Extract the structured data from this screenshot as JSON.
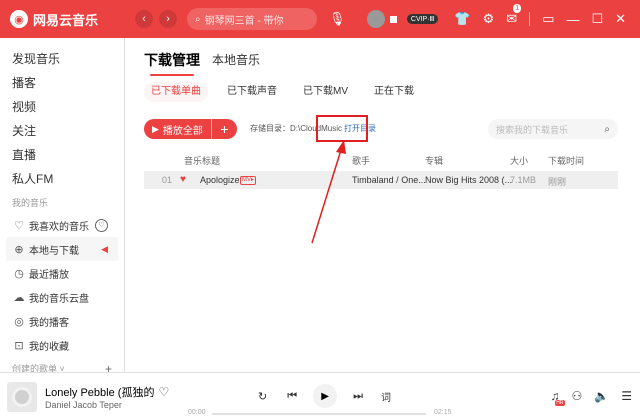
{
  "app": {
    "logo_text": "网易云音乐",
    "logo_glyph": "◉",
    "back": "‹",
    "forward": "›",
    "search_placeholder": "钢琴网三首 - 带你",
    "vip_label": "CVIP·Ⅲ",
    "message_count": "1",
    "accent_color": "#ec4141"
  },
  "sidebar": {
    "top_items": [
      {
        "label": "发现音乐"
      },
      {
        "label": "播客"
      },
      {
        "label": "视频"
      },
      {
        "label": "关注"
      },
      {
        "label": "直播"
      },
      {
        "label": "私人FM"
      }
    ],
    "my_music_heading": "我的音乐",
    "my_items": [
      {
        "label": "我喜欢的音乐",
        "icon": "heart-icon"
      },
      {
        "label": "本地与下载",
        "icon": "download-icon",
        "active": true
      },
      {
        "label": "最近播放",
        "icon": "clock-icon"
      },
      {
        "label": "我的音乐云盘",
        "icon": "cloud-icon"
      },
      {
        "label": "我的播客",
        "icon": "podcast-icon"
      },
      {
        "label": "我的收藏",
        "icon": "collect-icon"
      }
    ],
    "created_heading": "创建的歌单 ˅",
    "create_plus": "+"
  },
  "main": {
    "title": "下载管理",
    "title_alt": "本地音乐",
    "subtabs": [
      {
        "label": "已下载单曲",
        "active": true
      },
      {
        "label": "已下载声音"
      },
      {
        "label": "已下载MV"
      },
      {
        "label": "正在下载"
      }
    ],
    "play_all_label": "播放全部",
    "play_all_add": "+",
    "storage_label": "存储目录：D:\\CloudMusic",
    "open_dir_label": "打开目录",
    "search_placeholder": "搜索我的下载音乐",
    "table": {
      "headers": [
        "音乐标题",
        "歌手",
        "专辑",
        "大小",
        "下载时间"
      ],
      "rows": [
        {
          "num": "01",
          "title": "Apologize",
          "mv": "MV▸",
          "artist": "Timbaland / One...",
          "album": "Now Big Hits 2008 (...",
          "size": "7.1MB",
          "time": "刚刚"
        }
      ]
    }
  },
  "player": {
    "song_title": "Lonely Pebble (孤独的",
    "artist": "Daniel Jacob Teper",
    "current_time": "00:00",
    "total_time": "02:15",
    "progress": 0,
    "lyric_label": "词",
    "quality_tag": "HR"
  }
}
